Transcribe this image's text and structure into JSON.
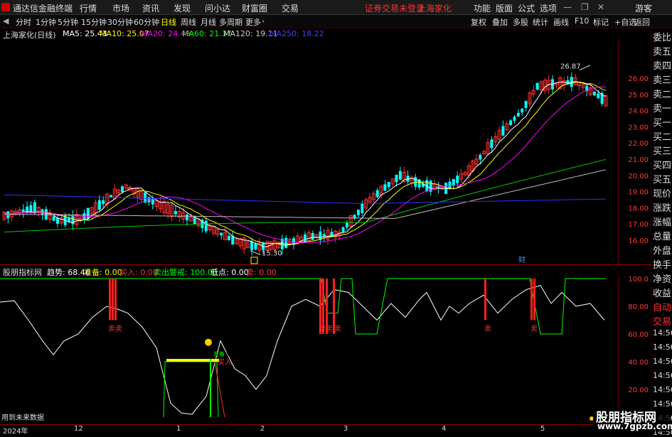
{
  "titlebar": {
    "app_name": "通达信金融终端",
    "menu": [
      "行情",
      "市场",
      "资讯",
      "发现",
      "问小达",
      "财富圈",
      "交易"
    ],
    "status": "证券交易未登录",
    "stock": "上海家化",
    "right_menu": [
      "功能",
      "版面",
      "公式",
      "选项"
    ],
    "guest": "游客"
  },
  "toolbar": {
    "periods": [
      "分时",
      "1分钟",
      "5分钟",
      "15分钟",
      "30分钟",
      "60分钟",
      "日线",
      "周线",
      "月线",
      "多周期",
      "更多"
    ],
    "right_buttons": [
      "复权",
      "叠加",
      "多股",
      "统计",
      "画线",
      "F10",
      "标记",
      "+自选",
      "返回"
    ]
  },
  "infobar": {
    "title": "上海家化(日线)",
    "ma": [
      {
        "label": "MA5: 25.43",
        "color": "#ffffff"
      },
      {
        "label": "MA10: 25.07",
        "color": "#ffff00"
      },
      {
        "label": "MA20: 24.49",
        "color": "#ff00ff"
      },
      {
        "label": "MA60: 21.37",
        "color": "#00ff00"
      },
      {
        "label": "MA120: 19.11",
        "color": "#cccccc"
      },
      {
        "label": "MA250: 18.22",
        "color": "#4040ff"
      }
    ]
  },
  "sidebar": {
    "items": [
      "委比",
      "卖五",
      "卖四",
      "卖三",
      "卖二",
      "卖一",
      "买一",
      "买二",
      "买三",
      "买四",
      "买五",
      "现价",
      "涨跌",
      "涨幅",
      "总量",
      "外盘",
      "换手",
      "净资",
      "收益",
      "自动",
      "交易",
      "14:56",
      "14:56",
      "14:56",
      "14:56",
      "14:56",
      "14:56",
      "14:56",
      "14:56"
    ]
  },
  "indicator": {
    "title": "股朋指标网",
    "fields": [
      {
        "label": "趋势: 68.46",
        "color": "#ffffff"
      },
      {
        "label": "准备: 0.00",
        "color": "#ffff00"
      },
      {
        "label": "买入: 0.00",
        "color": "#ff3030"
      },
      {
        "label": "卖出警戒: 100.00",
        "color": "#00ff00"
      },
      {
        "label": "低点: 0.00",
        "color": "#ffffff"
      },
      {
        "label": "卖: 0.00",
        "color": "#ff3030"
      }
    ],
    "yticks": [
      "100.0",
      "80.00",
      "60.00",
      "40.00",
      "20.00"
    ],
    "sell_labels": [
      "卖卖",
      "卖卖",
      "卖",
      "卖",
      "卖"
    ],
    "buy_label": "买入",
    "ready_label": "准备准备准备准备准备准备准备准备",
    "ready2_label": "准备",
    "note": "用到未来数据"
  },
  "price": {
    "yticks": [
      "26.00",
      "25.00",
      "24.00",
      "23.00",
      "22.00",
      "21.00",
      "20.00",
      "19.00",
      "18.00",
      "17.00",
      "16.00"
    ],
    "high_label": "26.87",
    "low_label": "15.30",
    "cai_label": "财"
  },
  "xaxis": {
    "labels": [
      "2024年",
      "12",
      "1",
      "2",
      "3",
      "4",
      "5"
    ]
  },
  "watermark": {
    "line1": "股朋指标网",
    "line2": "www.7gpzb.com"
  },
  "chart_data": {
    "type": "candlestick",
    "price_range": [
      15.3,
      26.87
    ]
  }
}
